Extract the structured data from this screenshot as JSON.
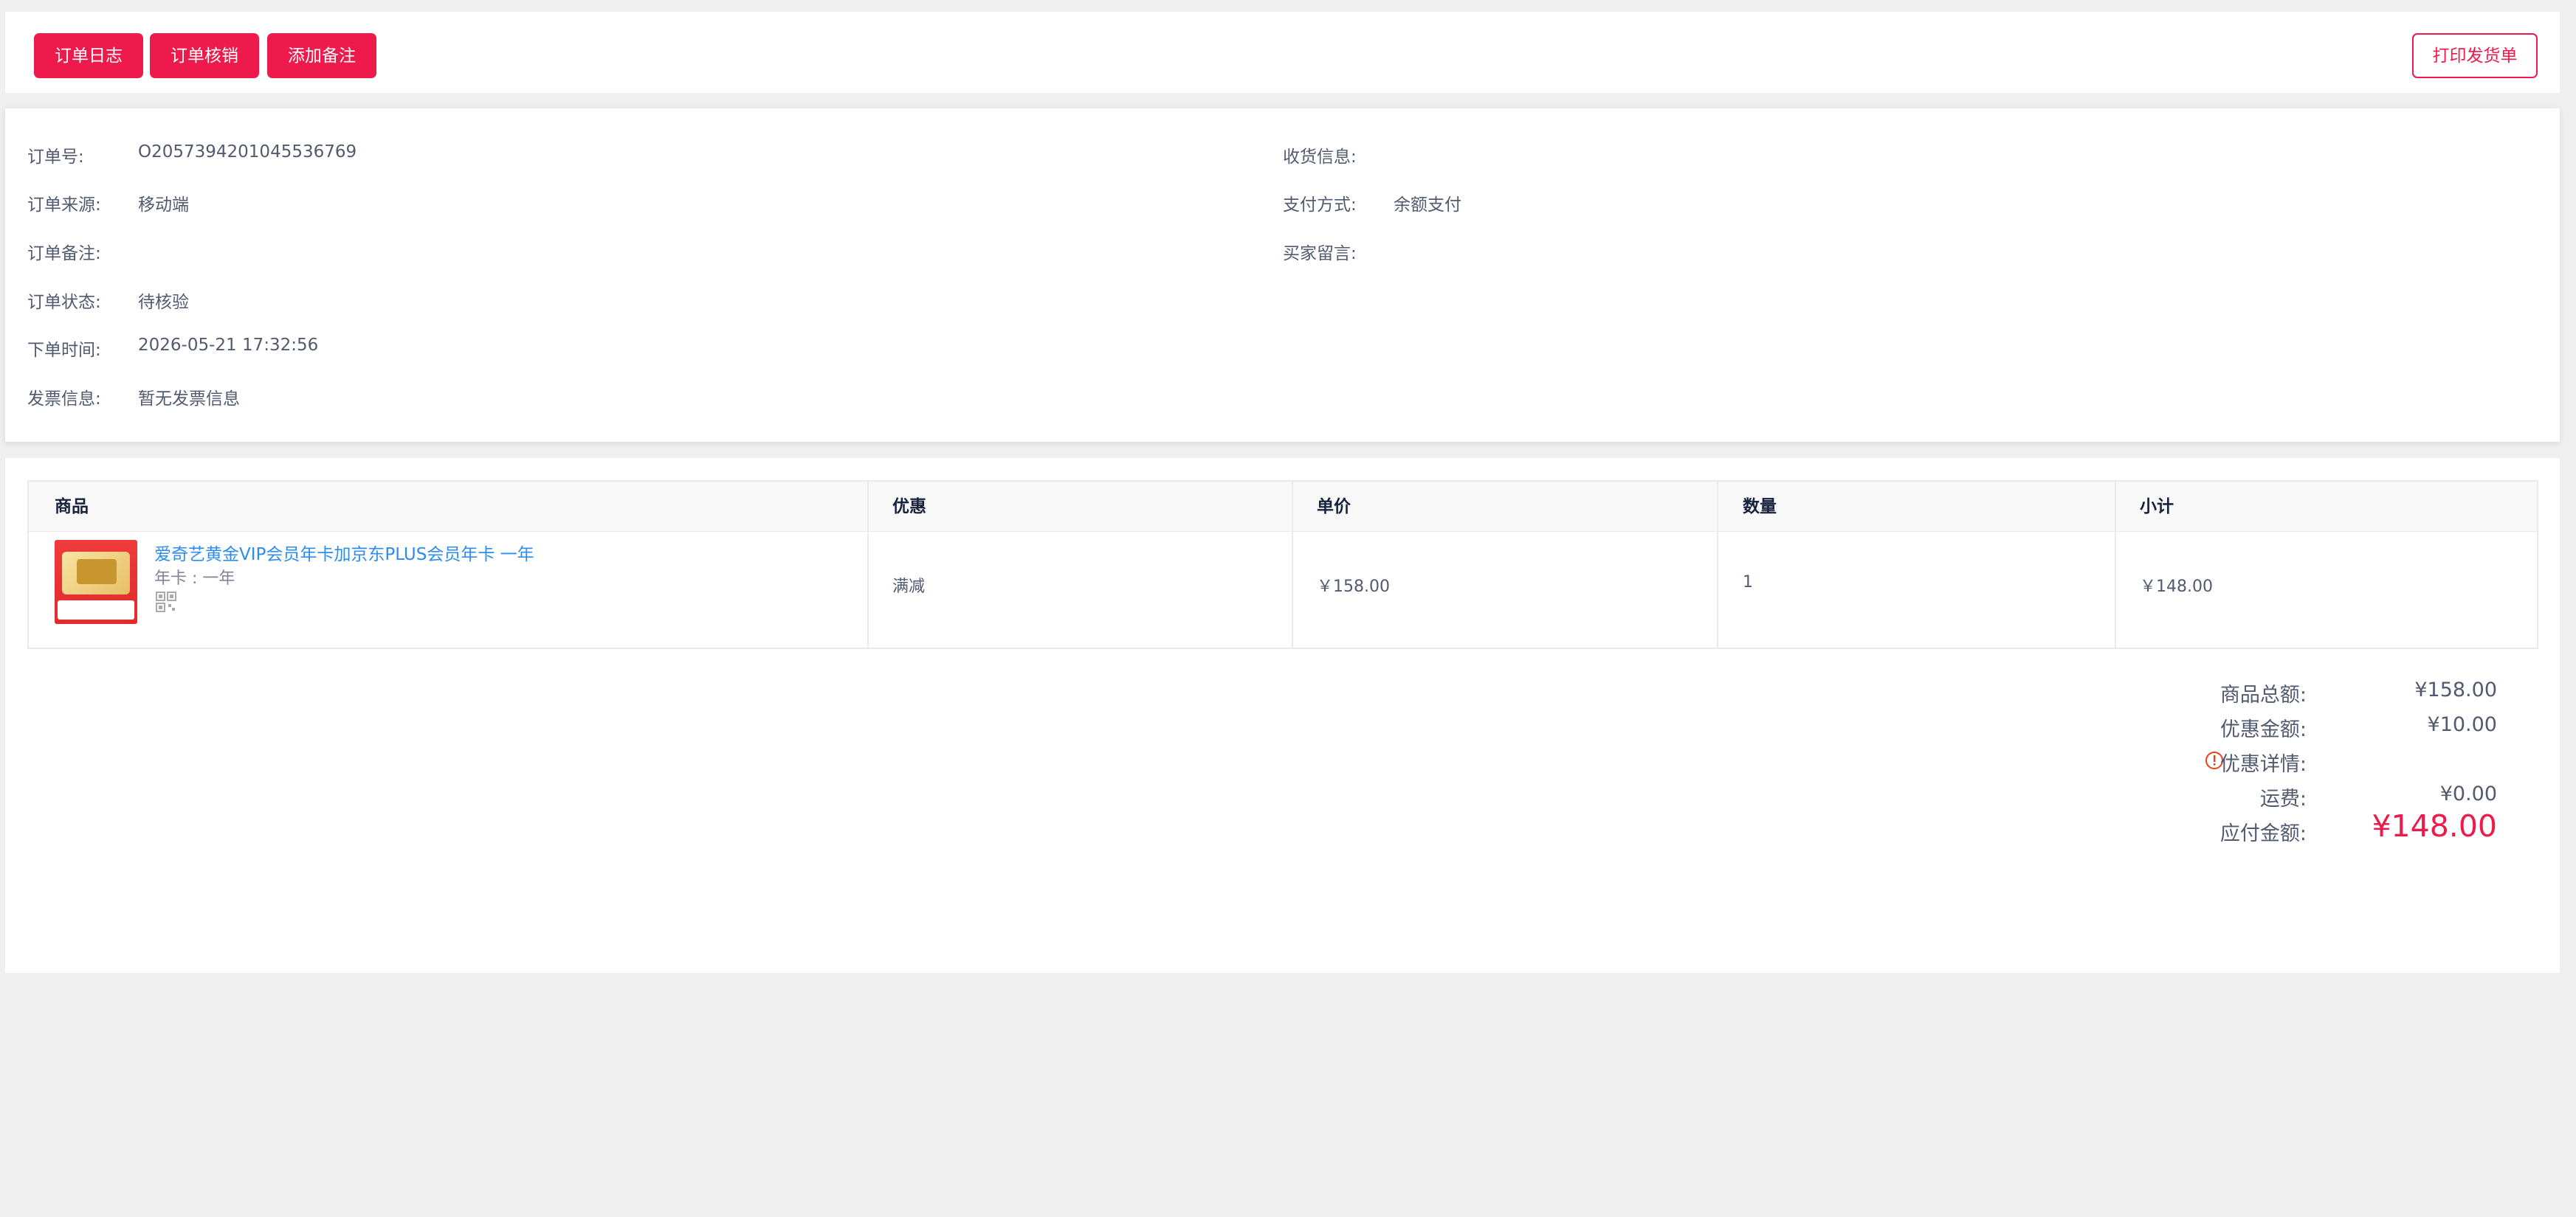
{
  "toolbar": {
    "order_log": "订单日志",
    "order_verify": "订单核销",
    "add_remark": "添加备注",
    "print_invoice": "打印发货单"
  },
  "info": {
    "order_no_label": "订单号:",
    "order_no": "O2057394201045536769",
    "source_label": "订单来源:",
    "source": "移动端",
    "remark_label": "订单备注:",
    "remark": "",
    "status_label": "订单状态:",
    "status": "待核验",
    "time_label": "下单时间:",
    "time": "2026-05-21 17:32:56",
    "invoice_label": "发票信息:",
    "invoice": "暂无发票信息",
    "receiver_label": "收货信息:",
    "receiver": "",
    "payment_label": "支付方式:",
    "payment": "余额支付",
    "buyer_msg_label": "买家留言:",
    "buyer_msg": ""
  },
  "goods": {
    "headers": {
      "product": "商品",
      "discount": "优惠",
      "unit_price": "单价",
      "quantity": "数量",
      "subtotal": "小计"
    },
    "row": {
      "name": "爱奇艺黄金VIP会员年卡加京东PLUS会员年卡 一年",
      "spec": "年卡 : 一年",
      "thumb_price": "158",
      "discount": "满减",
      "unit_price": "￥158.00",
      "quantity": "1",
      "subtotal": "￥148.00"
    }
  },
  "totals": {
    "goods_total_label": "商品总额:",
    "goods_total": "¥158.00",
    "discount_label": "优惠金额:",
    "discount": "¥10.00",
    "discount_detail_label": "优惠详情:",
    "shipping_label": "运费:",
    "shipping": "¥0.00",
    "payable_label": "应付金额:",
    "payable": "¥148.00"
  },
  "colors": {
    "accent": "#ed1a4b",
    "link": "#2d8cf0",
    "text": "#515a6e",
    "background": "#efefef"
  }
}
